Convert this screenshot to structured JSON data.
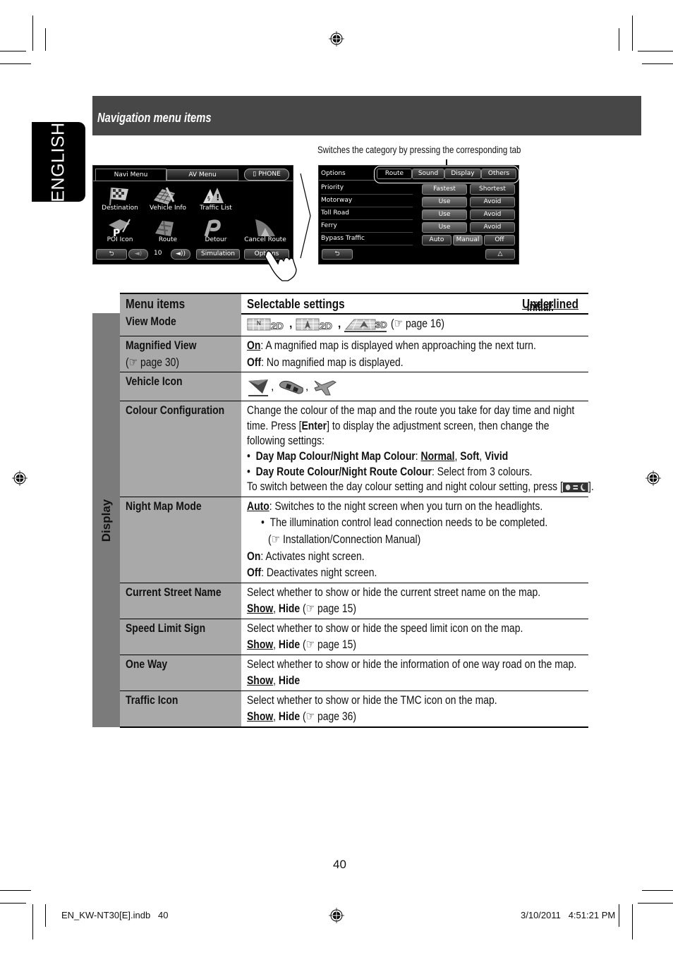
{
  "language_tab": "ENGLISH",
  "section_title": "Navigation menu items",
  "callout": "Switches the category by pressing the corresponding tab",
  "navi_screen": {
    "tabs": [
      "Navi Menu",
      "AV Menu",
      "PHONE"
    ],
    "icons": [
      "Destination",
      "Vehicle Info",
      "Traffic List",
      "POI Icon",
      "Route",
      "Detour",
      "Cancel Route"
    ],
    "volume_value": "10",
    "buttons": {
      "simulation": "Simulation",
      "options": "Options"
    }
  },
  "options_screen": {
    "title": "Options",
    "tabs": [
      "Route",
      "Sound",
      "Display",
      "Others"
    ],
    "rows": [
      {
        "label": "Priority",
        "buttons": [
          "Fastest",
          "Shortest"
        ]
      },
      {
        "label": "Motorway",
        "buttons": [
          "Use",
          "Avoid"
        ]
      },
      {
        "label": "Toll Road",
        "buttons": [
          "Use",
          "Avoid"
        ]
      },
      {
        "label": "Ferry",
        "buttons": [
          "Use",
          "Avoid"
        ]
      },
      {
        "label": "Bypass Traffic",
        "buttons": [
          "Auto",
          "Manual",
          "Off"
        ]
      }
    ]
  },
  "table": {
    "header_items": "Menu items",
    "header_settings": "Selectable settings",
    "initial_label": "Initial: ",
    "initial_value": "Underlined",
    "group": "Display",
    "rows": {
      "view_mode": {
        "name": "View Mode",
        "ref": "(☞ page 16)"
      },
      "magnified_view": {
        "name": "Magnified View",
        "sub": "(☞ page 30)",
        "on_k": "On",
        "on_t": ": A magnified map is displayed when approaching the next turn.",
        "off_k": "Off",
        "off_t": ": No magnified map is displayed."
      },
      "vehicle_icon": {
        "name": "Vehicle Icon"
      },
      "colour_config": {
        "name": "Colour Configuration",
        "l1": "Change the colour of the map and the route you take for day time and night",
        "l2a": "time. Press [",
        "l2b": "Enter",
        "l2c": "] to display the adjustment screen, then change the",
        "l3": "following settings:",
        "b1k": "Day Map Colour/Night Map Colour",
        "b1a": "Normal",
        "b1b": "Soft",
        "b1c": "Vivid",
        "b2k": "Day Route Colour/Night Route Colour",
        "b2t": ": Select from 3 colours.",
        "l6": "To switch between the day colour setting and night colour setting, press ["
      },
      "night_map": {
        "name": "Night Map Mode",
        "auto_k": "Auto",
        "auto_t": ": Switches to the night screen when you turn on the headlights.",
        "bullet": "The illumination control lead connection needs to be completed.",
        "ref": "(☞ Installation/Connection Manual)",
        "on_k": "On",
        "on_t": ": Activates night screen.",
        "off_k": "Off",
        "off_t": ": Deactivates night screen."
      },
      "street_name": {
        "name": "Current Street Name",
        "desc": "Select whether to show or hide the current street name on the map.",
        "show": "Show",
        "hide": "Hide",
        "ref": " (☞ page 15)"
      },
      "speed_limit": {
        "name": "Speed Limit Sign",
        "desc": "Select whether to show or hide the speed limit icon on the map.",
        "show": "Show",
        "hide": "Hide",
        "ref": " (☞ page 15)"
      },
      "one_way": {
        "name": "One Way",
        "desc": "Select whether to show or hide the information of one way road on the map.",
        "show": "Show",
        "hide": "Hide",
        "ref": ""
      },
      "traffic_icon": {
        "name": "Traffic Icon",
        "desc": "Select whether to show or hide the TMC icon on the map.",
        "show": "Show",
        "hide": "Hide",
        "ref": " (☞ page 36)"
      }
    }
  },
  "page_number": "40",
  "footer": {
    "file": "EN_KW-NT30[E].indb   40",
    "timestamp": "3/10/2011   4:51:21 PM"
  }
}
